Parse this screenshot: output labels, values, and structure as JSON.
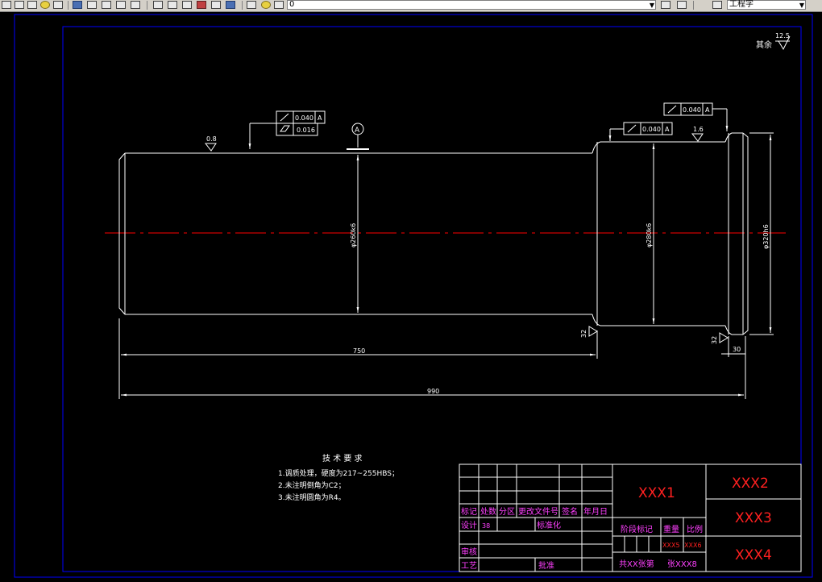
{
  "toolbar": {
    "layer_value": "0",
    "style_value": "工程字",
    "icons": [
      "match-properties-icon",
      "copy-icon",
      "paste-icon",
      "brush-icon",
      "undo-icon",
      "redo-icon",
      "pan-icon",
      "zoom-realtime-icon",
      "zoom-window-icon",
      "zoom-previous-icon",
      "properties-icon",
      "design-center-icon",
      "tool-palettes-icon",
      "markup-icon",
      "calculator-icon",
      "help-icon",
      "layer-manager-icon",
      "layer-state-icon",
      "layer-previous-icon",
      "dim-style-icon"
    ]
  },
  "drawing": {
    "roughness_other": {
      "label": "其余",
      "value": "12.5"
    },
    "roughness_left": "0.8",
    "roughness_right": "1.6",
    "roughness_32_a": "32",
    "roughness_32_b": "32",
    "datum": "A",
    "tol_left_runout": "0.040",
    "tol_left_runout_datum": "A",
    "tol_left_cyl": "0.016",
    "tol_mid_runout": "0.040",
    "tol_mid_runout_datum": "A",
    "tol_right_runout": "0.040",
    "tol_right_runout_datum": "A",
    "dia_left": "φ260k6",
    "dia_mid": "φ280k6",
    "dia_right": "φ320h6",
    "len_750": "750",
    "len_990": "990",
    "len_30": "30",
    "tech_title": "技 术 要 求",
    "tech_lines": [
      "1.调质处理，硬度为217~255HBS；",
      "2.未注明倒角为C2；",
      "3.未注明圆角为R4。"
    ]
  },
  "title_block": {
    "xxx1": "XXX1",
    "xxx2": "XXX2",
    "xxx3": "XXX3",
    "xxx4": "XXX4",
    "xxx5": "XXX5",
    "xxx6": "XXX6",
    "sheets": "共XX张第",
    "sheets_b": "张XXX8",
    "h_mark": "标记",
    "h_count": "处数",
    "h_zone": "分区",
    "h_doc": "更改文件号",
    "h_sign": "签名",
    "h_date": "年月日",
    "design": "设计",
    "design_val": "38",
    "std": "标准化",
    "stage": "阶段标记",
    "weight": "重量",
    "scale": "比例",
    "check": "审核",
    "process": "工艺",
    "approve": "批准"
  },
  "colors": {
    "line": "#ffffff",
    "center": "#ff0000",
    "dim": "#ffffff",
    "text_red": "#ff2020",
    "text_mag": "#ff40ff",
    "frame": "#0000ff"
  }
}
